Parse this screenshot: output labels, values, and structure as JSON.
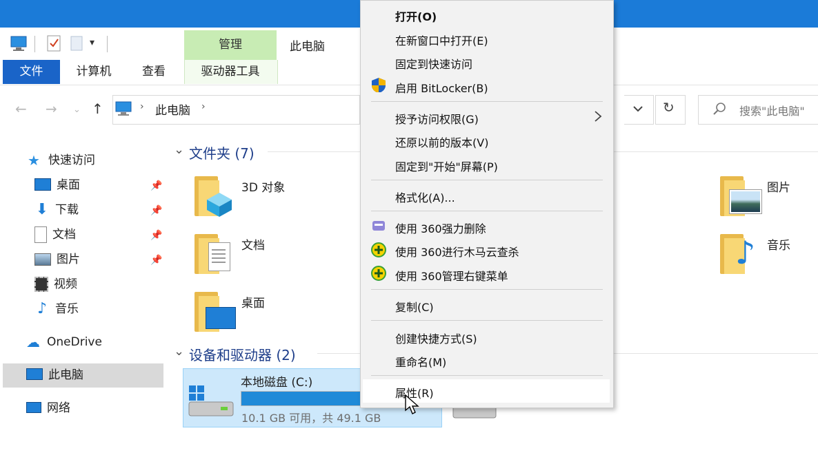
{
  "ribbon": {
    "tabs": [
      "文件",
      "计算机",
      "查看",
      "驱动器工具"
    ],
    "contextual_group": "管理",
    "window_title": "此电脑"
  },
  "address": {
    "path_item": "此电脑",
    "search_placeholder": "搜索\"此电脑\""
  },
  "nav": {
    "quick_access": "快速访问",
    "items": [
      "桌面",
      "下载",
      "文档",
      "图片",
      "视频",
      "音乐"
    ],
    "onedrive": "OneDrive",
    "this_pc": "此电脑",
    "network": "网络"
  },
  "content": {
    "folders_header": "文件夹 (7)",
    "folders": [
      "3D 对象",
      "文档",
      "桌面",
      "图片",
      "音乐"
    ],
    "devices_header": "设备和驱动器 (2)",
    "drive": {
      "name": "本地磁盘 (C:)",
      "space": "10.1 GB 可用，共 49.1 GB",
      "used_fraction": 0.79
    }
  },
  "context_menu": {
    "items": [
      "打开(O)",
      "在新窗口中打开(E)",
      "固定到快速访问",
      "启用 BitLocker(B)",
      "授予访问权限(G)",
      "还原以前的版本(V)",
      "固定到\"开始\"屏幕(P)",
      "格式化(A)...",
      "使用 360强力删除",
      "使用 360进行木马云查杀",
      "使用 360管理右键菜单",
      "复制(C)",
      "创建快捷方式(S)",
      "重命名(M)",
      "属性(R)"
    ],
    "submenu_arrow": "chevron-right-icon"
  },
  "colors": {
    "titlebar": "#1b7bd8",
    "file_tab": "#1a64c8",
    "manage": "#c8ecb4",
    "selection": "#cde8fb",
    "drive_bar": "#1f8ad8"
  }
}
